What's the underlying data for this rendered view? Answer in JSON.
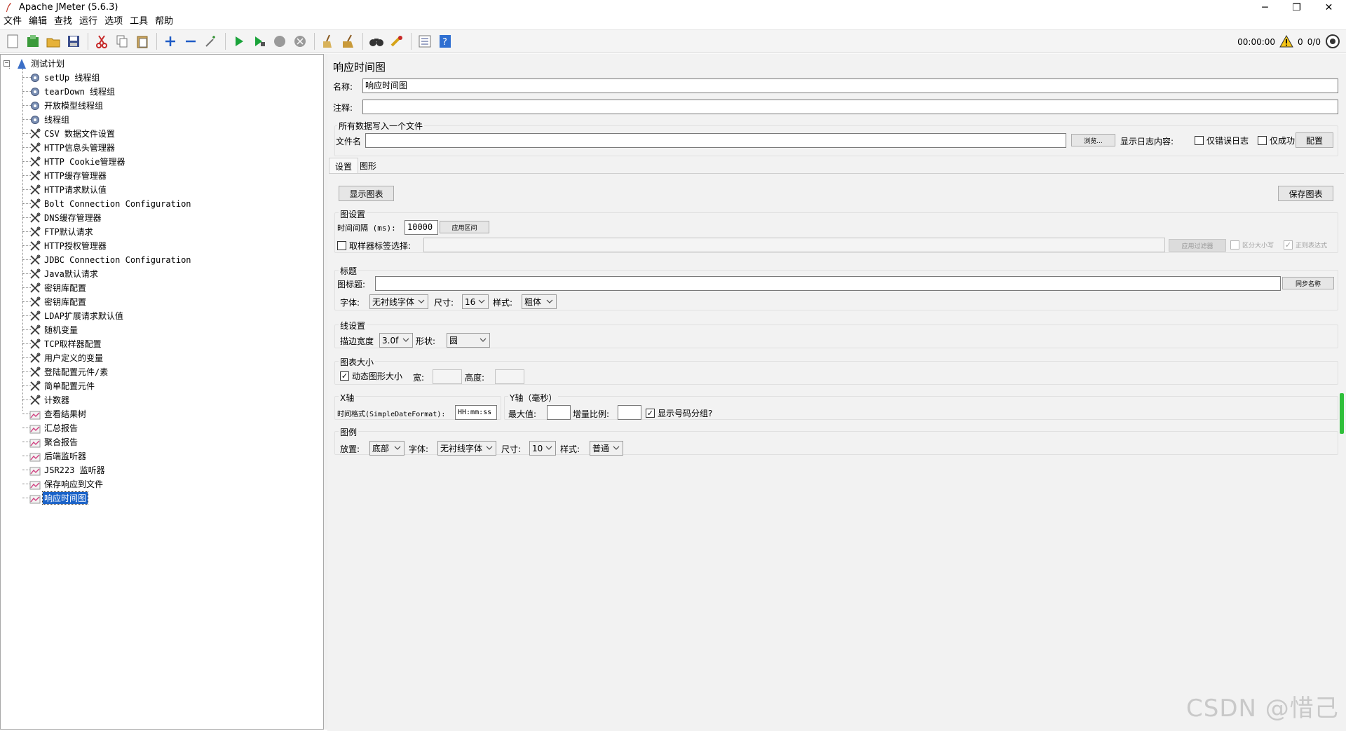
{
  "window": {
    "title": "Apache JMeter (5.6.3)",
    "minimize": "─",
    "maximize": "❐",
    "close": "✕"
  },
  "menu": [
    "文件",
    "编辑",
    "查找",
    "运行",
    "选项",
    "工具",
    "帮助"
  ],
  "toolbar_status": {
    "elapsed": "00:00:00",
    "warnings": "0",
    "threads": "0/0"
  },
  "tree": {
    "root": "测试计划",
    "items": [
      {
        "label": "setUp 线程组",
        "icon": "gear-icon"
      },
      {
        "label": "tearDown 线程组",
        "icon": "gear-icon"
      },
      {
        "label": "开放模型线程组",
        "icon": "gear-icon"
      },
      {
        "label": "线程组",
        "icon": "gear-icon"
      },
      {
        "label": "CSV 数据文件设置",
        "icon": "wrench-icon"
      },
      {
        "label": "HTTP信息头管理器",
        "icon": "wrench-icon"
      },
      {
        "label": "HTTP Cookie管理器",
        "icon": "wrench-icon"
      },
      {
        "label": "HTTP缓存管理器",
        "icon": "wrench-icon"
      },
      {
        "label": "HTTP请求默认值",
        "icon": "wrench-icon"
      },
      {
        "label": "Bolt Connection Configuration",
        "icon": "wrench-icon"
      },
      {
        "label": "DNS缓存管理器",
        "icon": "wrench-icon"
      },
      {
        "label": "FTP默认请求",
        "icon": "wrench-icon"
      },
      {
        "label": "HTTP授权管理器",
        "icon": "wrench-icon"
      },
      {
        "label": "JDBC Connection Configuration",
        "icon": "wrench-icon"
      },
      {
        "label": "Java默认请求",
        "icon": "wrench-icon"
      },
      {
        "label": "密钥库配置",
        "icon": "wrench-icon"
      },
      {
        "label": "密钥库配置",
        "icon": "wrench-icon"
      },
      {
        "label": "LDAP扩展请求默认值",
        "icon": "wrench-icon"
      },
      {
        "label": "随机变量",
        "icon": "wrench-icon"
      },
      {
        "label": "TCP取样器配置",
        "icon": "wrench-icon"
      },
      {
        "label": "用户定义的变量",
        "icon": "wrench-icon"
      },
      {
        "label": "登陆配置元件/素",
        "icon": "wrench-icon"
      },
      {
        "label": "简单配置元件",
        "icon": "wrench-icon"
      },
      {
        "label": "计数器",
        "icon": "wrench-icon"
      },
      {
        "label": "查看结果树",
        "icon": "listener-icon"
      },
      {
        "label": "汇总报告",
        "icon": "listener-icon"
      },
      {
        "label": "聚合报告",
        "icon": "listener-icon"
      },
      {
        "label": "后端监听器",
        "icon": "listener-icon"
      },
      {
        "label": "JSR223 监听器",
        "icon": "listener-icon"
      },
      {
        "label": "保存响应到文件",
        "icon": "listener-icon"
      },
      {
        "label": "响应时间图",
        "icon": "listener-icon"
      }
    ],
    "selected_index": 30
  },
  "panel": {
    "heading": "响应时间图",
    "name_label": "名称:",
    "name_value": "响应时间图",
    "comment_label": "注释:",
    "comment_value": "",
    "file_section_title": "所有数据写入一个文件",
    "file_label": "文件名",
    "file_value": "",
    "browse": "浏览...",
    "log_label": "显示日志内容:",
    "errors_only": "仅错误日志",
    "success_only": "仅成功日志",
    "configure": "配置",
    "tabs": [
      "设置",
      "图形"
    ],
    "display_graph": "显示图表",
    "save_graph": "保存图表",
    "graph_settings": {
      "title": "图设置",
      "interval_label": "时间间隔 (ms):",
      "interval_value": "10000",
      "apply_interval": "应用区间",
      "sampler_label": "取样器标签选择:",
      "apply_filter": "应用过滤器",
      "case_sensitive": "区分大小写",
      "regex": "正则表达式"
    },
    "title_section": {
      "title": "标题",
      "graph_title_label": "图标题:",
      "graph_title_value": "",
      "sync_name": "同步名称",
      "font_label": "字体:",
      "font_value": "无衬线字体",
      "size_label": "尺寸:",
      "size_value": "16",
      "style_label": "样式:",
      "style_value": "粗体"
    },
    "line_section": {
      "title": "线设置",
      "stroke_label": "描边宽度",
      "stroke_value": "3.0f",
      "shape_label": "形状:",
      "shape_value": "圆"
    },
    "size_section": {
      "title": "图表大小",
      "dynamic_label": "动态图形大小",
      "width_label": "宽:",
      "height_label": "高度:"
    },
    "xaxis": {
      "title": "X轴",
      "format_label": "时间格式(SimpleDateFormat):",
      "format_value": "HH:mm:ss"
    },
    "yaxis": {
      "title": "Y轴（毫秒）",
      "max_label": "最大值:",
      "increment_label": "增量比例:",
      "group_label": "显示号码分组?"
    },
    "legend": {
      "title": "图例",
      "placement_label": "放置:",
      "placement_value": "底部",
      "font_label": "字体:",
      "font_value": "无衬线字体",
      "size_label": "尺寸:",
      "size_value": "10",
      "style_label": "样式:",
      "style_value": "普通"
    }
  },
  "watermark": "CSDN @惜己",
  "colors": {
    "selection": "#1a62c8",
    "panel_bg": "#f2f2f2",
    "play_green": "#1aa33a"
  }
}
